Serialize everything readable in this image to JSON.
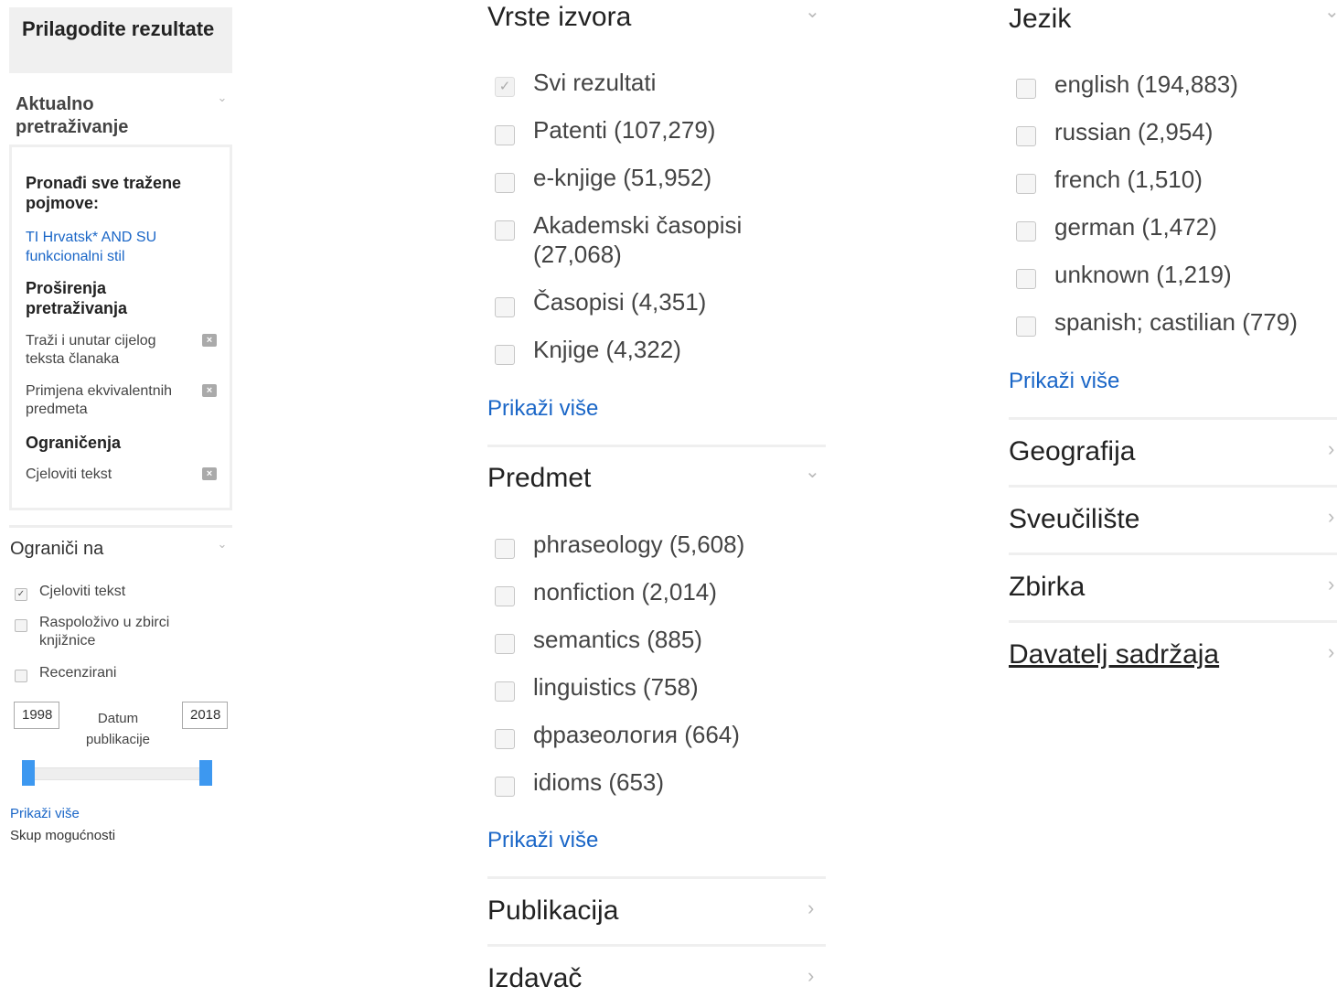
{
  "sidebar": {
    "title": "Prilagodite rezultate",
    "current_search": {
      "heading": "Aktualno pretraživanje",
      "find_all_label": "Pronađi sve tražene pojmove:",
      "query_link": "TI Hrvatsk* AND SU funkcionalni stil",
      "expanders_heading": "Proširenja pretraživanja",
      "expanders": [
        "Traži i unutar cijelog teksta članaka",
        "Primjena ekvivalentnih predmeta"
      ],
      "limits_heading": "Ograničenja",
      "limits": [
        "Cjeloviti tekst"
      ]
    },
    "limit_to": {
      "heading": "Ograniči na",
      "options": [
        {
          "label": "Cjeloviti tekst",
          "checked": true
        },
        {
          "label": "Raspoloživo u zbirci knjižnice",
          "checked": false
        },
        {
          "label": "Recenzirani",
          "checked": false
        }
      ],
      "date_from": "1998",
      "date_to": "2018",
      "date_label": "Datum publikacije",
      "show_more": "Prikaži više",
      "options_set": "Skup mogućnosti"
    }
  },
  "source_types": {
    "heading": "Vrste izvora",
    "items": [
      {
        "label": "Svi rezultati",
        "checked": true
      },
      {
        "label": "Patenti (107,279)",
        "checked": false
      },
      {
        "label": "e-knjige (51,952)",
        "checked": false
      },
      {
        "label": "Akademski časopisi (27,068)",
        "checked": false
      },
      {
        "label": "Časopisi (4,351)",
        "checked": false
      },
      {
        "label": "Knjige (4,322)",
        "checked": false
      }
    ],
    "show_more": "Prikaži više"
  },
  "subject": {
    "heading": "Predmet",
    "items": [
      {
        "label": "phraseology (5,608)",
        "checked": false
      },
      {
        "label": "nonfiction (2,014)",
        "checked": false
      },
      {
        "label": "semantics (885)",
        "checked": false
      },
      {
        "label": "linguistics (758)",
        "checked": false
      },
      {
        "label": "фразеология (664)",
        "checked": false
      },
      {
        "label": "idioms (653)",
        "checked": false
      }
    ],
    "show_more": "Prikaži više"
  },
  "collapsed_mid": [
    "Publikacija",
    "Izdavač"
  ],
  "language": {
    "heading": "Jezik",
    "items": [
      {
        "label": "english (194,883)",
        "checked": false
      },
      {
        "label": "russian (2,954)",
        "checked": false
      },
      {
        "label": "french (1,510)",
        "checked": false
      },
      {
        "label": "german (1,472)",
        "checked": false
      },
      {
        "label": "unknown (1,219)",
        "checked": false
      },
      {
        "label": "spanish; castilian (779)",
        "checked": false
      }
    ],
    "show_more": "Prikaži više"
  },
  "collapsed_right": [
    "Geografija",
    "Sveučilište",
    "Zbirka",
    "Davatelj sadržaja"
  ],
  "icons": {
    "chevron_down": "chevron-down-icon",
    "chevron_right": "chevron-right-icon",
    "remove": "remove-icon",
    "check": "checkmark-icon"
  }
}
